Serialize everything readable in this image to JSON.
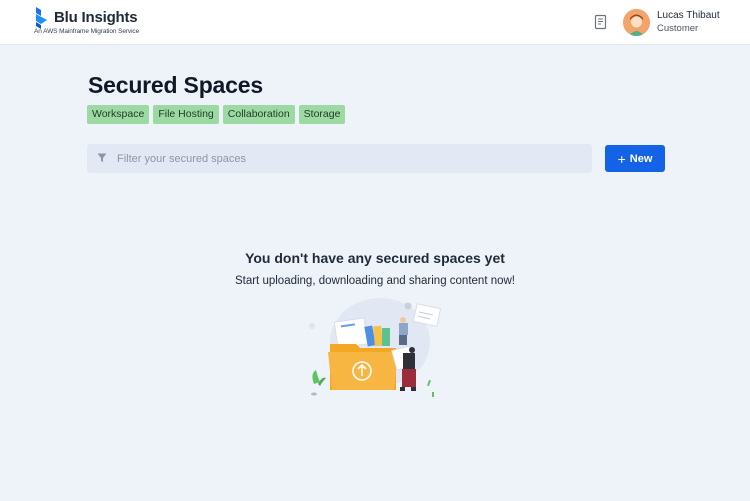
{
  "header": {
    "logo_title": "Blu Insights",
    "logo_subtitle": "An AWS Mainframe Migration Service",
    "logo_icon": "blu-logo-icon",
    "docs_icon": "book-icon",
    "user": {
      "name": "Lucas Thibaut",
      "role": "Customer",
      "avatar_icon": "avatar-icon"
    }
  },
  "main": {
    "title": "Secured Spaces",
    "tags": [
      "Workspace",
      "File Hosting",
      "Collaboration",
      "Storage"
    ],
    "filter": {
      "placeholder": "Filter your secured spaces",
      "value": "",
      "icon": "filter-icon"
    },
    "new_button": {
      "label": "New",
      "icon": "plus-icon"
    },
    "empty_state": {
      "title": "You don't have any secured spaces yet",
      "subtitle": "Start uploading, downloading and sharing content now!",
      "illustration_icon": "folder-upload-illustration"
    }
  },
  "colors": {
    "accent": "#1463e6",
    "tag_bg": "#9dd9a3",
    "background": "#eef2f9",
    "folder": "#f5a623"
  }
}
